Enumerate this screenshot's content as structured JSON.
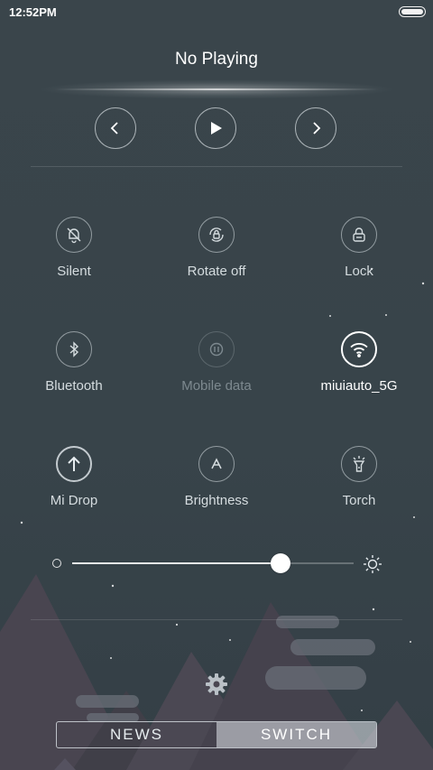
{
  "status_bar": {
    "time": "12:52PM",
    "battery_level": 1.0
  },
  "media": {
    "title": "No Playing",
    "controls": [
      {
        "name": "previous-button",
        "icon": "chevron-left-icon"
      },
      {
        "name": "play-button",
        "icon": "play-icon"
      },
      {
        "name": "next-button",
        "icon": "chevron-right-icon"
      }
    ]
  },
  "toggles": [
    {
      "label": "Silent",
      "icon": "bell-off-icon",
      "state": "off"
    },
    {
      "label": "Rotate off",
      "icon": "rotate-lock-icon",
      "state": "off"
    },
    {
      "label": "Lock",
      "icon": "lock-icon",
      "state": "off"
    },
    {
      "label": "Bluetooth",
      "icon": "bluetooth-icon",
      "state": "off"
    },
    {
      "label": "Mobile data",
      "icon": "mobile-data-icon",
      "state": "disabled"
    },
    {
      "label": "miuiauto_5G",
      "icon": "wifi-icon",
      "state": "on"
    },
    {
      "label": "Mi Drop",
      "icon": "upload-arrow-icon",
      "state": "off"
    },
    {
      "label": "Brightness",
      "icon": "auto-brightness-icon",
      "state": "off"
    },
    {
      "label": "Torch",
      "icon": "flashlight-icon",
      "state": "off"
    }
  ],
  "brightness": {
    "level": 0.74,
    "min_icon": "dim-circle-icon",
    "max_icon": "sun-icon"
  },
  "settings_icon": "gear-icon",
  "tabs": [
    {
      "label": "NEWS",
      "active": false
    },
    {
      "label": "SWITCH",
      "active": true
    }
  ],
  "colors": {
    "background": "#3a454b",
    "accent": "#ffffff",
    "mountain": "#4a4650"
  }
}
